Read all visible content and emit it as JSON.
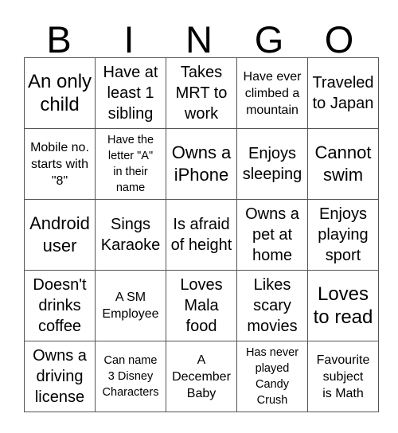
{
  "header": {
    "letters": [
      "B",
      "I",
      "N",
      "G",
      "O"
    ]
  },
  "board": {
    "rows": [
      [
        "An only\nchild",
        "Have at\nleast 1\nsibling",
        "Takes\nMRT to\nwork",
        "Have ever\nclimbed a\nmountain",
        "Traveled\nto Japan"
      ],
      [
        "Mobile no.\nstarts with\n\"8\"",
        "Have the\nletter \"A\"\nin their\nname",
        "Owns a\niPhone",
        "Enjoys\nsleeping",
        "Cannot\nswim"
      ],
      [
        "Android\nuser",
        "Sings\nKaraoke",
        "Is afraid\nof height",
        "Owns a\npet at\nhome",
        "Enjoys\nplaying\nsport"
      ],
      [
        "Doesn't\ndrinks\ncoffee",
        "A SM\nEmployee",
        "Loves\nMala\nfood",
        "Likes\nscary\nmovies",
        "Loves\nto read"
      ],
      [
        "Owns a\ndriving\nlicense",
        "Can name\n3 Disney\nCharacters",
        "A\nDecember\nBaby",
        "Has never\nplayed\nCandy\nCrush",
        "Favourite\nsubject\nis Math"
      ]
    ]
  }
}
